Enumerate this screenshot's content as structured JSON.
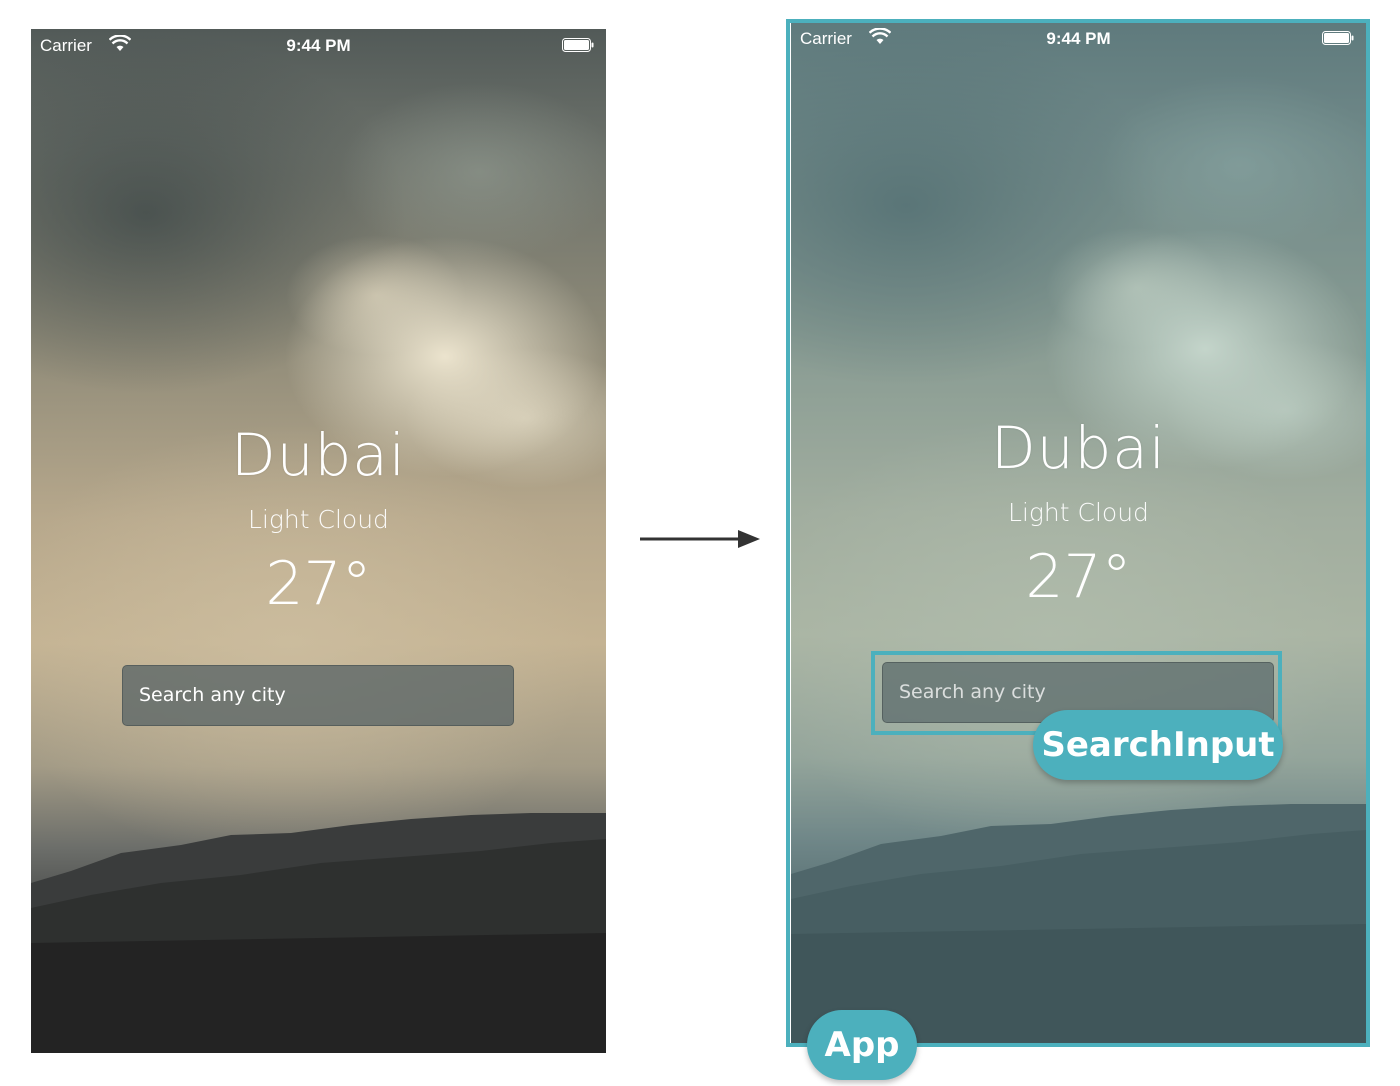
{
  "left_screen": {
    "status": {
      "carrier": "Carrier",
      "time": "9:44 PM"
    },
    "city": "Dubai",
    "condition": "Light Cloud",
    "temperature": "27°",
    "search": {
      "placeholder": "Search any city"
    }
  },
  "right_screen": {
    "status": {
      "carrier": "Carrier",
      "time": "9:44 PM"
    },
    "city": "Dubai",
    "condition": "Light Cloud",
    "temperature": "27°",
    "search": {
      "placeholder": "Search any city"
    }
  },
  "annotations": {
    "search_component_label": "SearchInput",
    "app_component_label": "App"
  },
  "colors": {
    "annotation_accent": "#4cb0bd",
    "text": "#ffffff",
    "arrow": "#333333"
  },
  "icons": [
    "wifi-icon",
    "battery-icon",
    "arrow-right-icon"
  ]
}
